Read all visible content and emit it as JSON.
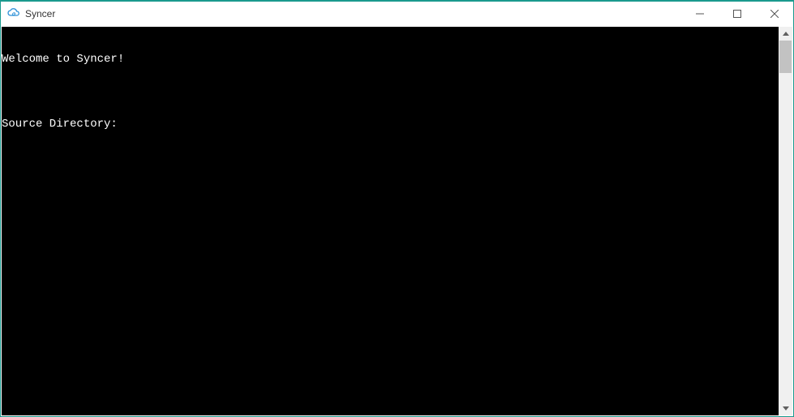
{
  "window": {
    "title": "Syncer"
  },
  "console": {
    "lines": [
      "Welcome to Syncer!",
      "",
      "Source Directory:"
    ]
  }
}
